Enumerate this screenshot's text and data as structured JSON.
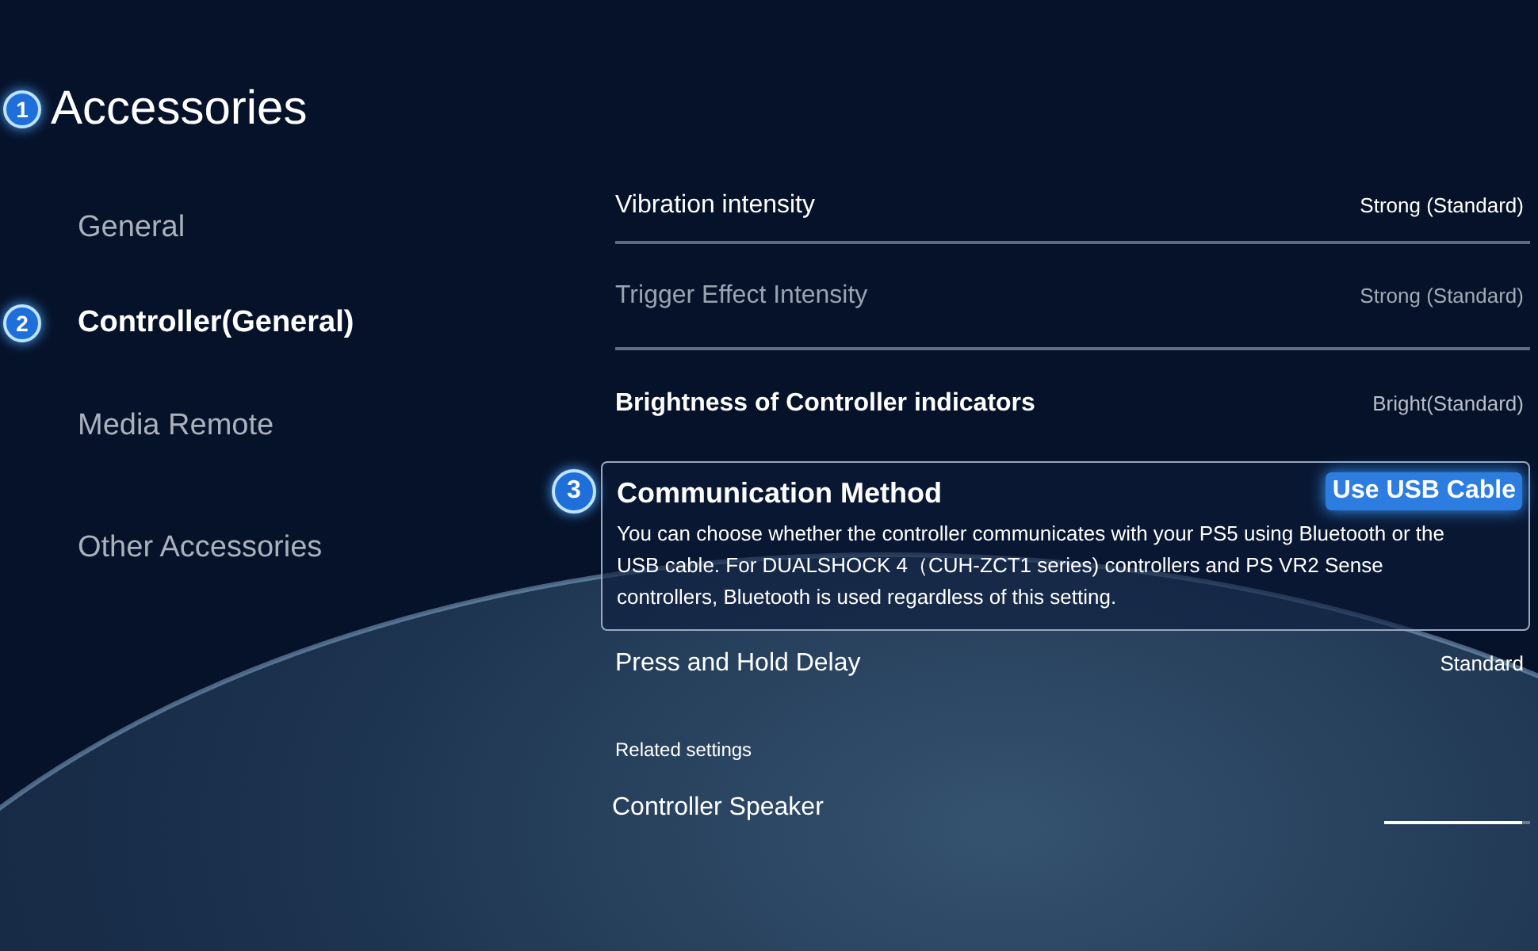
{
  "header": {
    "callout": "1",
    "title": "Accessories"
  },
  "sidebar": {
    "items": [
      {
        "label": "General",
        "selected": false
      },
      {
        "label": "Controller(General)",
        "selected": true,
        "callout": "2"
      },
      {
        "label": "Media Remote",
        "selected": false
      },
      {
        "label": "Other Accessories",
        "selected": false
      }
    ]
  },
  "settings": [
    {
      "kind": "option",
      "label": "Vibration intensity",
      "value": "Strong (Standard)",
      "dimmed": false,
      "bold": false,
      "divider": true
    },
    {
      "kind": "option",
      "label": "Trigger Effect Intensity",
      "value": "Strong (Standard)",
      "dimmed": true,
      "bold": false,
      "divider": true
    },
    {
      "kind": "option",
      "label": "Brightness of Controller indicators",
      "value": "Bright(Standard)",
      "dimmed": false,
      "bold": true,
      "divider": false
    },
    {
      "kind": "focused",
      "callout": "3",
      "label": "Communication Method",
      "value": "Use USB Cable",
      "description": "You can choose whether the controller communicates with your PS5 using Bluetooth or the USB cable. For DUALSHOCK 4（CUH-ZCT1 series) controllers and PS VR2 Sense controllers, Bluetooth is  used regardless of this setting."
    },
    {
      "kind": "option",
      "label": "Press and Hold Delay",
      "value": "Standard",
      "dimmed": false,
      "bold": false,
      "divider": false
    },
    {
      "kind": "heading",
      "label": "Related settings"
    },
    {
      "kind": "slider",
      "label": "Controller Speaker",
      "level": 0.95
    }
  ]
}
